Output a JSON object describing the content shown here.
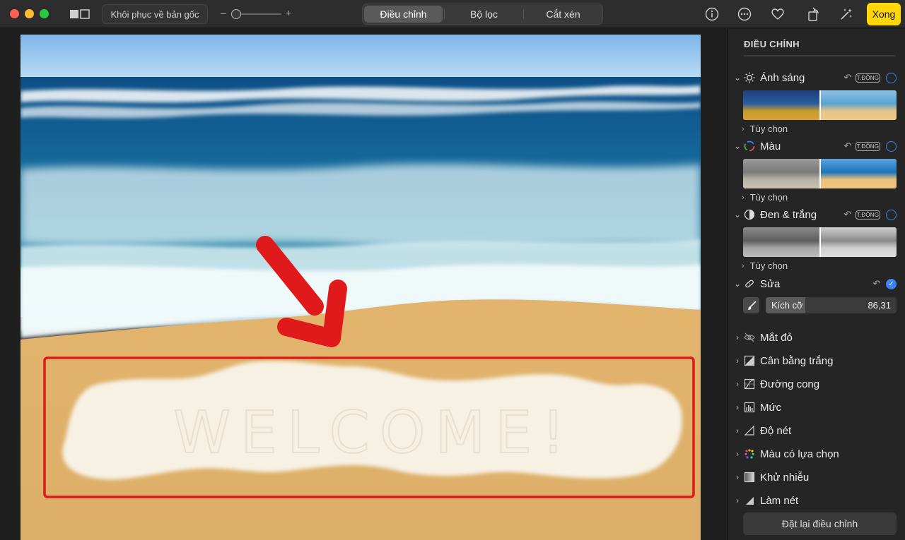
{
  "toolbar": {
    "revert_label": "Khôi phục về bản gốc",
    "zoom_minus": "–",
    "zoom_plus": "+",
    "tabs": [
      {
        "label": "Điều chỉnh",
        "active": true
      },
      {
        "label": "Bộ lọc",
        "active": false
      },
      {
        "label": "Cắt xén",
        "active": false
      }
    ],
    "done_label": "Xong",
    "done_color": "#ffd60a"
  },
  "photo": {
    "sand_text": "WELCOME!",
    "highlight_color": "#e01a1a"
  },
  "sidebar": {
    "title": "ĐIỀU CHỈNH",
    "auto_badge": "T.ĐỘNG",
    "options_label": "Tùy chọn",
    "sections_expanded": [
      {
        "label": "Ánh sáng",
        "icon": "sun-icon"
      },
      {
        "label": "Màu",
        "icon": "color-wheel-icon"
      },
      {
        "label": "Đen & trắng",
        "icon": "half-circle-icon"
      },
      {
        "label": "Sửa",
        "icon": "bandage-icon"
      }
    ],
    "retouch": {
      "size_label": "Kích cỡ",
      "size_value": "86,31",
      "size_fraction": 0.3
    },
    "sections_collapsed": [
      {
        "label": "Mắt đỏ",
        "icon": "eye-icon"
      },
      {
        "label": "Cân bằng trắng",
        "icon": "white-balance-icon"
      },
      {
        "label": "Đường cong",
        "icon": "curves-icon"
      },
      {
        "label": "Mức",
        "icon": "levels-icon"
      },
      {
        "label": "Độ nét",
        "icon": "sharpen-icon"
      },
      {
        "label": "Màu có lựa chọn",
        "icon": "selective-color-icon"
      },
      {
        "label": "Khử nhiễu",
        "icon": "noise-reduction-icon"
      },
      {
        "label": "Làm nét",
        "icon": "vignette-icon"
      }
    ],
    "reset_label": "Đặt lại điều chỉnh",
    "accent_color": "#3b82f6"
  }
}
